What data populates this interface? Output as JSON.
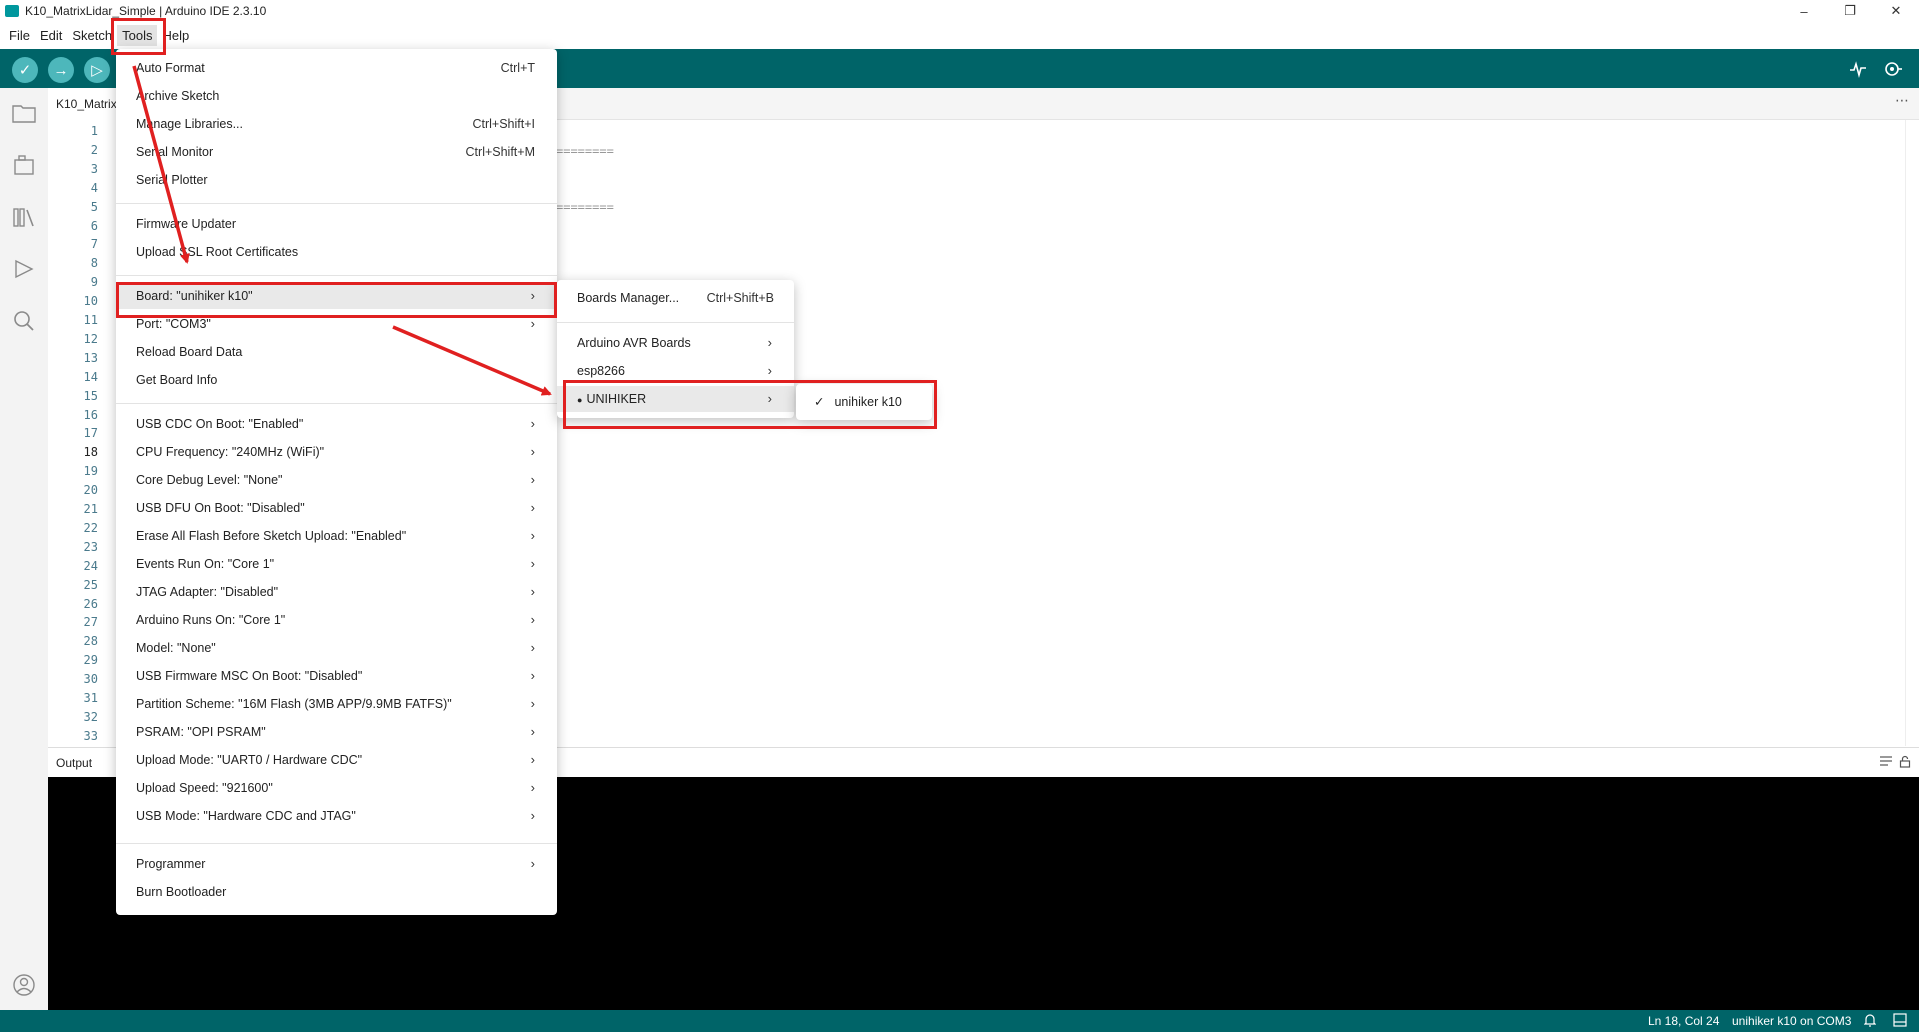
{
  "window": {
    "title": "K10_MatrixLidar_Simple | Arduino IDE 2.3.10",
    "minimize_glyph": "–",
    "maximize_glyph": "❐",
    "close_glyph": "✕"
  },
  "menubar": {
    "file": "File",
    "edit": "Edit",
    "sketch": "Sketch",
    "tools": "Tools",
    "help": "Help"
  },
  "toolbar": {
    "verify_glyph": "✓",
    "upload_glyph": "→",
    "debug_glyph": "▷"
  },
  "editor": {
    "tab_label": "K10_Matrix",
    "tab_more": "⋯",
    "line_numbers": [
      "1",
      "2",
      "3",
      "4",
      "5",
      "6",
      "7",
      "8",
      "9",
      "10",
      "11",
      "12",
      "13",
      "14",
      "15",
      "16",
      "17",
      "18",
      "19",
      "20",
      "21",
      "22",
      "23",
      "24",
      "25",
      "26",
      "27",
      "28",
      "29",
      "30",
      "31",
      "32",
      "33"
    ],
    "current_line": "18",
    "code_fragment_1": "========",
    "code_fragment_2": "========"
  },
  "output": {
    "label": "Output"
  },
  "statusbar": {
    "cursor": "Ln 18, Col 24",
    "board_port": "unihiker k10 on COM3"
  },
  "tools_menu": {
    "auto_format": "Auto Format",
    "auto_format_sc": "Ctrl+T",
    "archive_sketch": "Archive Sketch",
    "manage_libraries": "Manage Libraries...",
    "manage_libraries_sc": "Ctrl+Shift+I",
    "serial_monitor": "Serial Monitor",
    "serial_monitor_sc": "Ctrl+Shift+M",
    "serial_plotter": "Serial Plotter",
    "firmware_updater": "Firmware Updater",
    "upload_ssl": "Upload SSL Root Certificates",
    "board": "Board: \"unihiker k10\"",
    "port": "Port: \"COM3\"",
    "reload_board_data": "Reload Board Data",
    "get_board_info": "Get Board Info",
    "options": [
      "USB CDC On Boot: \"Enabled\"",
      "CPU Frequency: \"240MHz (WiFi)\"",
      "Core Debug Level: \"None\"",
      "USB DFU On Boot: \"Disabled\"",
      "Erase All Flash Before Sketch Upload: \"Enabled\"",
      "Events Run On: \"Core 1\"",
      "JTAG Adapter: \"Disabled\"",
      "Arduino Runs On: \"Core 1\"",
      "Model: \"None\"",
      "USB Firmware MSC On Boot: \"Disabled\"",
      "Partition Scheme: \"16M Flash (3MB APP/9.9MB FATFS)\"",
      "PSRAM: \"OPI PSRAM\"",
      "Upload Mode: \"UART0 / Hardware CDC\"",
      "Upload Speed: \"921600\"",
      "USB Mode: \"Hardware CDC and JTAG\""
    ],
    "programmer": "Programmer",
    "burn_bootloader": "Burn Bootloader",
    "submenu_arrow": "›"
  },
  "board_menu": {
    "boards_manager": "Boards Manager...",
    "boards_manager_sc": "Ctrl+Shift+B",
    "arduino_avr": "Arduino AVR Boards",
    "esp8266": "esp8266",
    "unihiker": "UNIHIKER",
    "unihiker_bullet": "●"
  },
  "unihiker_menu": {
    "check": "✓",
    "k10": "unihiker k10"
  },
  "colors": {
    "teal": "#006468",
    "annotation_red": "#e02020"
  }
}
